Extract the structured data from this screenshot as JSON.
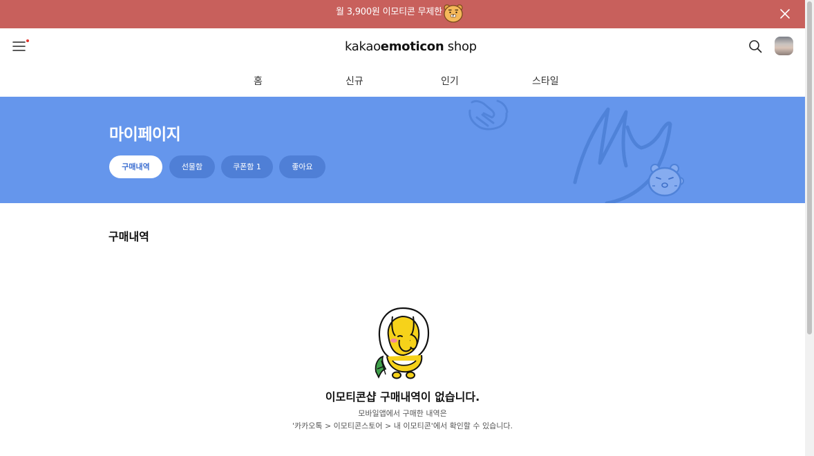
{
  "promo": {
    "text": "월 3,900원 이모티콘 무제한"
  },
  "header": {
    "logo_prefix": "kakao",
    "logo_bold": "emoticon",
    "logo_suffix": " shop",
    "nav": [
      "홈",
      "신규",
      "인기",
      "스타일"
    ]
  },
  "hero": {
    "title": "마이페이지",
    "tabs": [
      "구매내역",
      "선물함",
      "쿠폰함 1",
      "좋아요"
    ],
    "active_tab": "구매내역"
  },
  "main": {
    "section_title": "구매내역",
    "empty_title": "이모티콘샵 구매내역이 없습니다.",
    "empty_desc_1": "모바일앱에서 구매한 내역은",
    "empty_desc_2": "'카카오톡 > 이모티콘스토어 > 내 이모티콘'에서 확인할 수 있습니다."
  },
  "colors": {
    "promo_bg": "#c8605c",
    "hero_bg": "#6596ec",
    "pill_bg": "#4f7fd6",
    "notification_dot": "#e3362f"
  },
  "icons": [
    "menu-icon",
    "close-icon",
    "search-icon",
    "avatar",
    "character-illustration"
  ]
}
